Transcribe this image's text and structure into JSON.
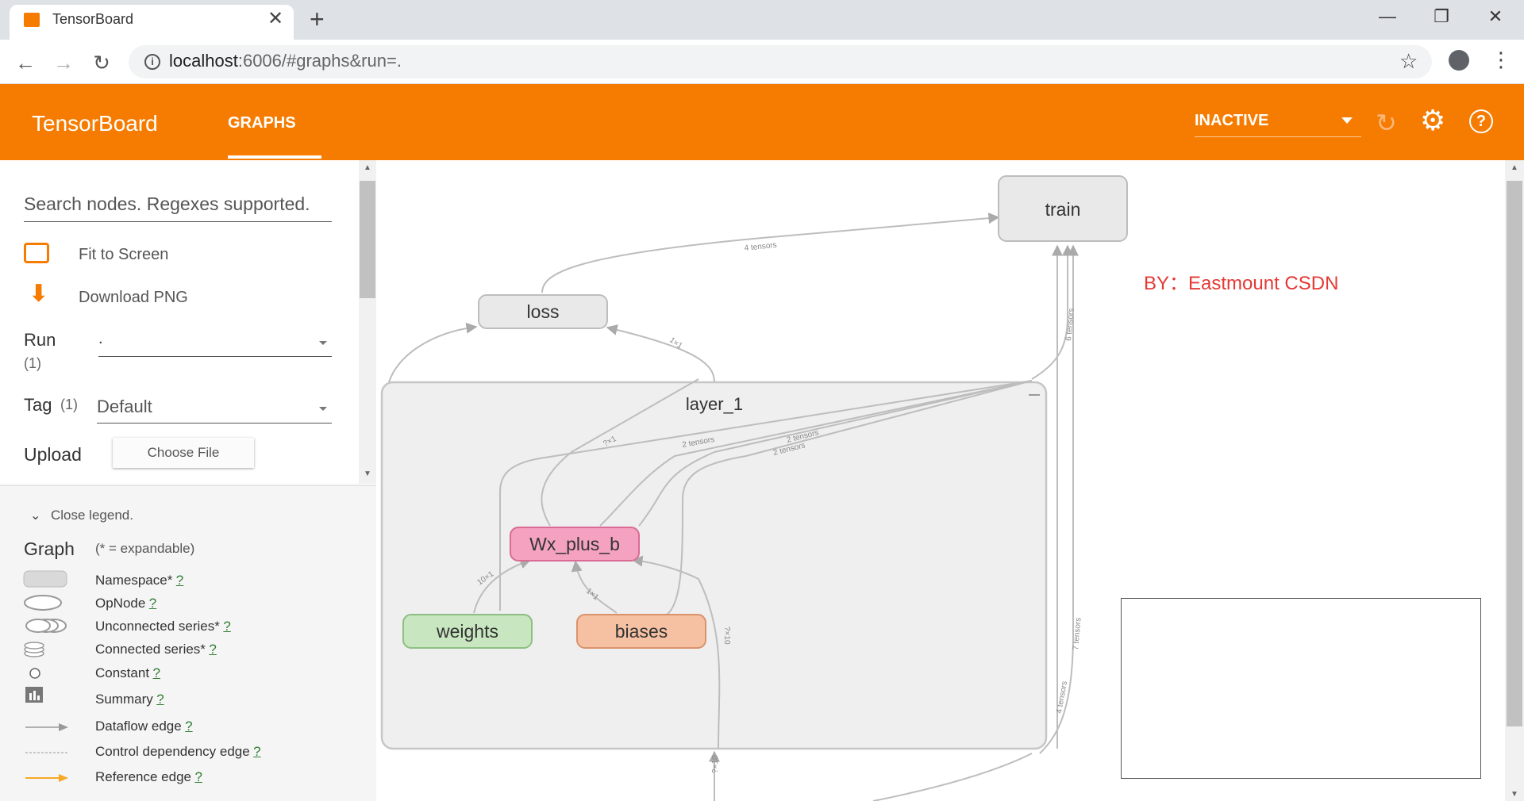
{
  "browser": {
    "tab_title": "TensorBoard",
    "url_host": "localhost",
    "url_rest": ":6006/#graphs&run=.",
    "close_tab": "✕",
    "new_tab": "+",
    "back": "←",
    "forward": "→",
    "reload": "↻",
    "star": "☆",
    "menu": "⋮",
    "win_min": "—",
    "win_max": "❐",
    "win_close": "✕"
  },
  "header": {
    "brand": "TensorBoard",
    "tab": "GRAPHS",
    "status": "INACTIVE",
    "accent_color": "#f57c00"
  },
  "controls": {
    "search_placeholder": "Search nodes. Regexes supported.",
    "fit_to_screen": "Fit to Screen",
    "download_png": "Download PNG",
    "run_label": "Run",
    "run_count": "(1)",
    "run_value": ".",
    "tag_label": "Tag",
    "tag_count": "(1)",
    "tag_value": "Default",
    "upload_label": "Upload",
    "choose_file": "Choose File"
  },
  "legend": {
    "close": "Close legend.",
    "title": "Graph",
    "subtitle": "(* = expandable)",
    "help": "?",
    "items": [
      {
        "label": "Namespace*"
      },
      {
        "label": "OpNode"
      },
      {
        "label": "Unconnected series*"
      },
      {
        "label": "Connected series*"
      },
      {
        "label": "Constant"
      },
      {
        "label": "Summary"
      },
      {
        "label": "Dataflow edge"
      },
      {
        "label": "Control dependency edge"
      },
      {
        "label": "Reference edge"
      }
    ]
  },
  "graph": {
    "nodes": {
      "train": "train",
      "loss": "loss",
      "layer": "layer_1",
      "wx": "Wx_plus_b",
      "weights": "weights",
      "biases": "biases"
    },
    "edges": {
      "loss_train": "4 tensors",
      "layer_loss": "1×1",
      "train_up": "6 tensors",
      "wx_up": "?×1",
      "layer_2a": "2 tensors",
      "layer_2b": "2 tensors",
      "layer_2c": "2 tensors",
      "weights_wx": "10×1",
      "biases_wx": "1×1",
      "bottom_in": "?×10",
      "bottom_in2": "?×10",
      "right_down": "7 tensors",
      "right_down2": "4 tensors"
    },
    "collapse": "—"
  },
  "watermark": "BY：Eastmount CSDN"
}
